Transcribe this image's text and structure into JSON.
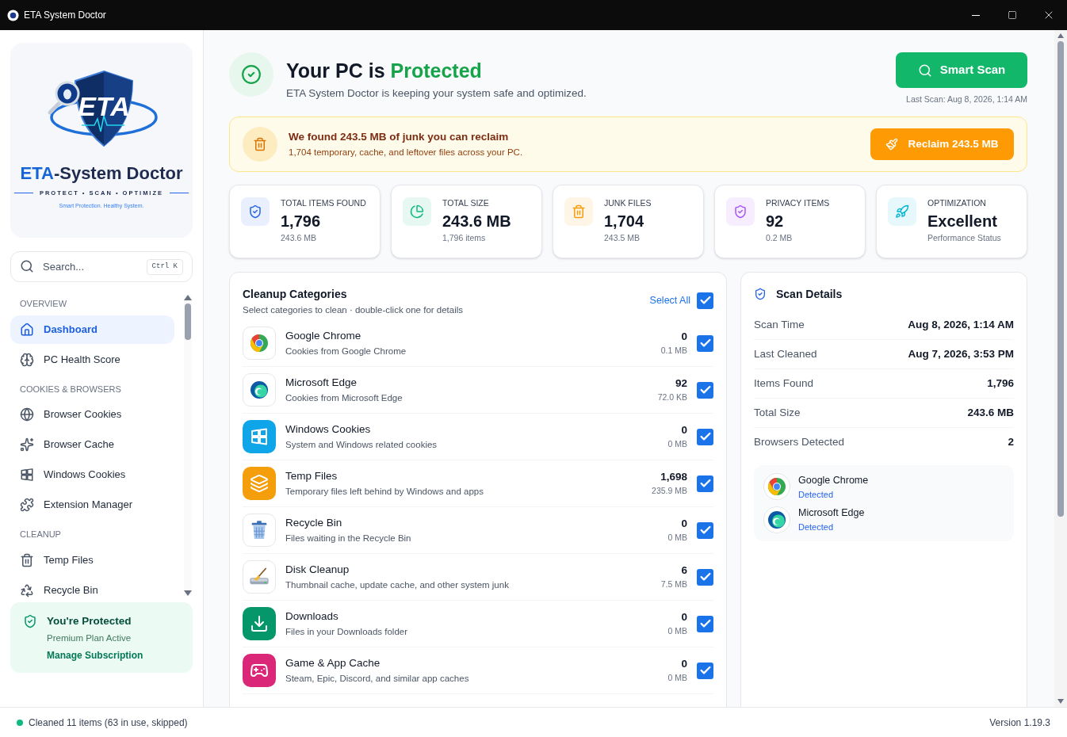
{
  "window": {
    "title": "ETA System Doctor"
  },
  "logo": {
    "mark": "ETA",
    "brand_accent": "ETA",
    "brand_rest": "-System Doctor",
    "tagline": "PROTECT • SCAN • OPTIMIZE",
    "slogan": "Smart Protection. Healthy System."
  },
  "search": {
    "placeholder": "Search...",
    "shortcut": "Ctrl K"
  },
  "sidebar": {
    "sections": [
      {
        "heading": "OVERVIEW",
        "items": [
          {
            "label": "Dashboard",
            "kind": "home",
            "selected": true
          },
          {
            "label": "PC Health Score",
            "kind": "health",
            "selected": false
          }
        ]
      },
      {
        "heading": "COOKIES & BROWSERS",
        "items": [
          {
            "label": "Browser Cookies",
            "kind": "globe",
            "selected": false
          },
          {
            "label": "Browser Cache",
            "kind": "sparkles",
            "selected": false
          },
          {
            "label": "Windows Cookies",
            "kind": "windows",
            "selected": false
          },
          {
            "label": "Extension Manager",
            "kind": "puzzle",
            "selected": false
          }
        ]
      },
      {
        "heading": "CLEANUP",
        "items": [
          {
            "label": "Temp Files",
            "kind": "trash",
            "selected": false
          },
          {
            "label": "Recycle Bin",
            "kind": "recycle",
            "selected": false
          }
        ]
      }
    ]
  },
  "protection": {
    "title": "You're Protected",
    "plan": "Premium Plan Active",
    "link": "Manage Subscription"
  },
  "header": {
    "title_start": "Your PC is",
    "title_status": "Protected",
    "subtitle": "ETA System Doctor is keeping your system safe and optimized.",
    "scan_button": "Smart Scan",
    "last_scan": "Last Scan: Aug 8, 2026, 1:14 AM"
  },
  "junk_banner": {
    "title": "We found 243.5 MB of junk you can reclaim",
    "detail": "1,704 temporary, cache, and leftover files across your PC.",
    "button": "Reclaim 243.5 MB"
  },
  "stats": [
    {
      "label": "TOTAL ITEMS FOUND",
      "value": "1,796",
      "sub": "243.6 MB",
      "kind": "shield",
      "color": "#2563eb"
    },
    {
      "label": "TOTAL SIZE",
      "value": "243.6 MB",
      "sub": "1,796 items",
      "kind": "pie",
      "color": "#10b981"
    },
    {
      "label": "JUNK FILES",
      "value": "1,704",
      "sub": "243.5 MB",
      "kind": "trash",
      "color": "#f59e0b"
    },
    {
      "label": "PRIVACY ITEMS",
      "value": "92",
      "sub": "0.2 MB",
      "kind": "privacy",
      "color": "#a855f7"
    },
    {
      "label": "OPTIMIZATION",
      "value": "Excellent",
      "sub": "Performance Status",
      "kind": "rocket",
      "color": "#06b6d4"
    }
  ],
  "categories_panel": {
    "title": "Cleanup Categories",
    "subtitle": "Select categories to clean · double-click one for details",
    "select_all": "Select All",
    "all_checked": true
  },
  "categories": [
    {
      "name": "Google Chrome",
      "detail": "Cookies from Google Chrome",
      "count": "0",
      "size": "0.1 MB",
      "kind": "chrome",
      "checked": true
    },
    {
      "name": "Microsoft Edge",
      "detail": "Cookies from Microsoft Edge",
      "count": "92",
      "size": "72.0 KB",
      "kind": "edge",
      "checked": true
    },
    {
      "name": "Windows Cookies",
      "detail": "System and Windows related cookies",
      "count": "0",
      "size": "0 MB",
      "kind": "windows",
      "checked": true
    },
    {
      "name": "Temp Files",
      "detail": "Temporary files left behind by Windows and apps",
      "count": "1,698",
      "size": "235.9 MB",
      "kind": "temp",
      "checked": true
    },
    {
      "name": "Recycle Bin",
      "detail": "Files waiting in the Recycle Bin",
      "count": "0",
      "size": "0 MB",
      "kind": "recycle",
      "checked": true
    },
    {
      "name": "Disk Cleanup",
      "detail": "Thumbnail cache, update cache, and other system junk",
      "count": "6",
      "size": "7.5 MB",
      "kind": "disk",
      "checked": true
    },
    {
      "name": "Downloads",
      "detail": "Files in your Downloads folder",
      "count": "0",
      "size": "0 MB",
      "kind": "downloads",
      "checked": true
    },
    {
      "name": "Game & App Cache",
      "detail": "Steam, Epic, Discord, and similar app caches",
      "count": "0",
      "size": "0 MB",
      "kind": "game",
      "checked": true
    }
  ],
  "scan_details": {
    "title": "Scan Details",
    "rows": [
      {
        "label": "Scan Time",
        "value": "Aug 8, 2026, 1:14 AM"
      },
      {
        "label": "Last Cleaned",
        "value": "Aug 7, 2026, 3:53 PM"
      },
      {
        "label": "Items Found",
        "value": "1,796"
      },
      {
        "label": "Total Size",
        "value": "243.6 MB"
      },
      {
        "label": "Browsers Detected",
        "value": "2"
      }
    ],
    "browsers": [
      {
        "name": "Google Chrome",
        "status": "Detected",
        "kind": "chrome"
      },
      {
        "name": "Microsoft Edge",
        "status": "Detected",
        "kind": "edge"
      }
    ]
  },
  "status_bar": {
    "message": "Cleaned 11 items (63 in use, skipped)",
    "version": "Version 1.19.3"
  }
}
